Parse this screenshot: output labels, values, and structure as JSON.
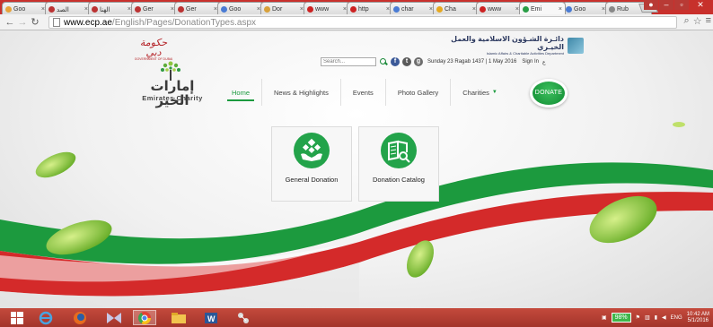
{
  "browser": {
    "tabs": [
      {
        "label": "Goo",
        "fav_color": "#e8a33a"
      },
      {
        "label": "الصد",
        "fav_color": "#b33"
      },
      {
        "label": "الهنا",
        "fav_color": "#b33"
      },
      {
        "label": "Ger",
        "fav_color": "#b33"
      },
      {
        "label": "Ger",
        "fav_color": "#b33"
      },
      {
        "label": "Goo",
        "fav_color": "#4a7bd4"
      },
      {
        "label": "Dor",
        "fav_color": "#d8a13a"
      },
      {
        "label": "www",
        "fav_color": "#c22"
      },
      {
        "label": "http",
        "fav_color": "#c22"
      },
      {
        "label": "char",
        "fav_color": "#4a7bd4"
      },
      {
        "label": "Cha",
        "fav_color": "#e6a81f"
      },
      {
        "label": "www",
        "fav_color": "#c22"
      },
      {
        "label": "Emi",
        "fav_color": "#2a9e46"
      },
      {
        "label": "Goo",
        "fav_color": "#4a7bd4"
      },
      {
        "label": "Rub",
        "fav_color": "#888"
      }
    ],
    "url_host": "www.ecp.ae",
    "url_path": "/English/Pages/DonationTypes.aspx"
  },
  "header": {
    "gov_logo_text": "حكومة دبي",
    "gov_logo_sub": "GOVERNMENT OF DUBAI",
    "dept_ar": "دائـرة الشـؤون الاسلامية والعمل الخيـري",
    "dept_en": "Islamic Affairs & Charitable Activities Department",
    "search_placeholder": "Search...",
    "social": [
      "f",
      "t",
      "g"
    ],
    "date": "Sunday 23 Ragab 1437 | 1 May 2016",
    "signin": "Sign In",
    "lang": "ع"
  },
  "logo": {
    "ar": "إمارات الخير",
    "en": "Emirates Charity"
  },
  "nav": {
    "items": [
      "Home",
      "News & Highlights",
      "Events",
      "Photo Gallery",
      "Charities"
    ],
    "caret": "▼",
    "donate": "DONATE"
  },
  "cards": [
    {
      "label": "General Donation"
    },
    {
      "label": "Donation Catalog"
    }
  ],
  "taskbar": {
    "battery": "98%",
    "lang": "ENG",
    "time": "10:42 AM",
    "date": "5/1/2016"
  },
  "colors": {
    "brand_green": "#1b9a3e",
    "brand_red": "#c8312b",
    "taskbar": "#b13d30"
  }
}
